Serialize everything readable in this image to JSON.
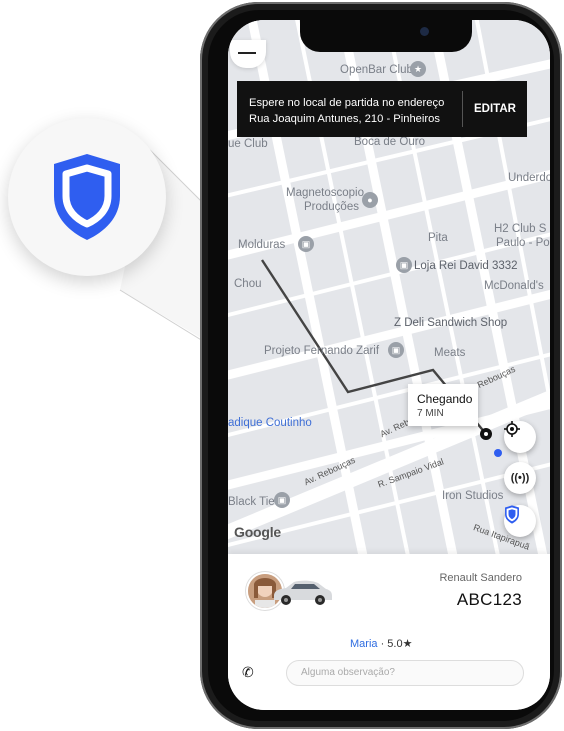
{
  "banner": {
    "line1": "Espere no local de partida no endereço",
    "line2": "Rua Joaquim Antunes, 210 - Pinheiros",
    "button": "EDITAR"
  },
  "map": {
    "pois": [
      {
        "name": "OpenBar Club"
      },
      {
        "name": "ue Club"
      },
      {
        "name": "Boca de Ouro"
      },
      {
        "name": "Underdo"
      },
      {
        "name": "Magnetoscopio"
      },
      {
        "name": "Produções"
      },
      {
        "name": "Pita"
      },
      {
        "name": "H2 Club S"
      },
      {
        "name": "Paulo - Po"
      },
      {
        "name": "Molduras"
      },
      {
        "name": "Loja Rei David 3332"
      },
      {
        "name": "Chou"
      },
      {
        "name": "McDonald's"
      },
      {
        "name": "Z Deli Sandwich Shop"
      },
      {
        "name": "Projeto Fernando Zarif"
      },
      {
        "name": "Meats"
      },
      {
        "name": "adique Coutinho"
      },
      {
        "name": "Black Tie"
      },
      {
        "name": "Iron Studios"
      }
    ],
    "streets": [
      "Rebouças",
      "Av. Rebouças",
      "Av. Rebouças",
      "R. Sampaio Vidal",
      "Rua Itapirapuã"
    ],
    "google_logo": "Google",
    "eta": {
      "title": "Chegando",
      "subtitle": "7 MIN"
    }
  },
  "fabs": {
    "locate": "locate-icon",
    "broadcast": "((•))",
    "shield": "shield-icon"
  },
  "trip": {
    "car_model": "Renault Sandero",
    "plate": "ABC123",
    "driver_name": "Maria",
    "rating": "· 5.0★",
    "message_placeholder": "Alguma observação?"
  },
  "colors": {
    "accent": "#2f5ef0",
    "route": "#444444",
    "map_bg": "#e4e6ea"
  }
}
